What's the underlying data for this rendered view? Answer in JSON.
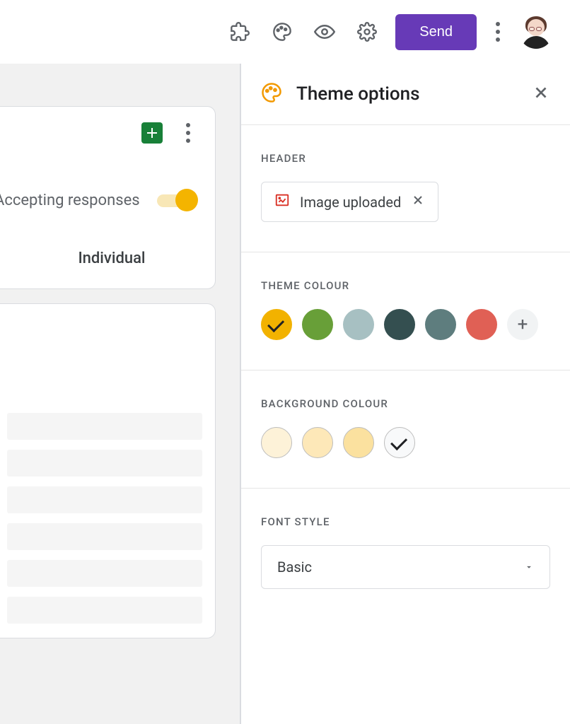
{
  "topbar": {
    "send_label": "Send"
  },
  "responses_card": {
    "accepting_label": "Accepting responses",
    "individual_tab": "Individual"
  },
  "theme_panel": {
    "title": "Theme options",
    "sections": {
      "header_label": "HEADER",
      "header_chip": "Image uploaded",
      "theme_colour_label": "THEME COLOUR",
      "background_colour_label": "BACKGROUND COLOUR",
      "font_style_label": "FONT STYLE",
      "font_style_value": "Basic"
    },
    "theme_colors": [
      {
        "hex": "#f2b200",
        "selected": true
      },
      {
        "hex": "#689f38",
        "selected": false
      },
      {
        "hex": "#a7c0c2",
        "selected": false
      },
      {
        "hex": "#344f50",
        "selected": false
      },
      {
        "hex": "#5e7d7e",
        "selected": false
      },
      {
        "hex": "#e06055",
        "selected": false
      }
    ],
    "background_colors": [
      {
        "hex": "#fdf2d8",
        "selected": false
      },
      {
        "hex": "#fde8b8",
        "selected": false
      },
      {
        "hex": "#fbe19f",
        "selected": false
      },
      {
        "hex": "#f8f9fa",
        "selected": true
      }
    ]
  }
}
